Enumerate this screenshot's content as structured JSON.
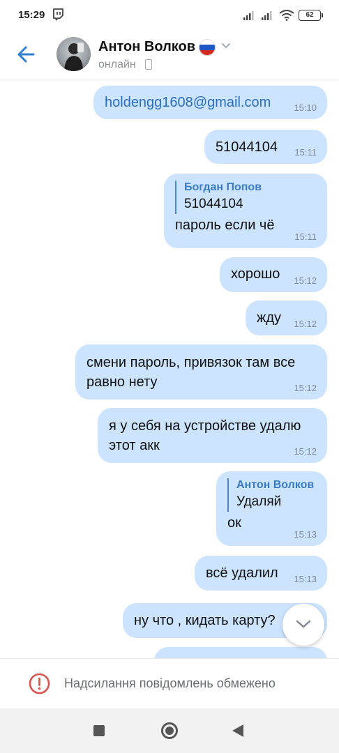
{
  "status_bar": {
    "time": "15:29",
    "battery": "62",
    "icons": [
      "twitch-icon",
      "signal-icon",
      "signal-icon",
      "wifi-icon",
      "battery-icon"
    ]
  },
  "header": {
    "contact_name": "Антон Волков",
    "status": "онлайн",
    "flag": "russia-flag-icon"
  },
  "messages": [
    {
      "text": "holdengg1608@gmail.com",
      "time": "15:10",
      "is_link": true
    },
    {
      "text": "51044104",
      "time": "15:11"
    },
    {
      "reply_author": "Богдан Попов",
      "reply_text": "51044104",
      "text": "пароль если чё",
      "time": "15:11"
    },
    {
      "text": "хорошо",
      "time": "15:12"
    },
    {
      "text": "жду",
      "time": "15:12"
    },
    {
      "text": "смени пароль, привязок там все\nравно нету",
      "time": "15:12"
    },
    {
      "text": "я у себя на устройстве удалю\nэтот акк",
      "time": "15:12"
    },
    {
      "reply_author": "Антон Волков",
      "reply_text": "Удаляй",
      "text": "ок",
      "time": "15:13"
    },
    {
      "text": "всё удалил",
      "time": "15:13"
    },
    {
      "text": "ну что , кидать карту?",
      "time": ""
    }
  ],
  "restricted": {
    "text": "Надсилання повідомлень обмежено"
  },
  "colors": {
    "bubble": "#cce4ff",
    "accent": "#3a7cc2",
    "link": "#2a6fbd",
    "warning": "#d9534f"
  }
}
